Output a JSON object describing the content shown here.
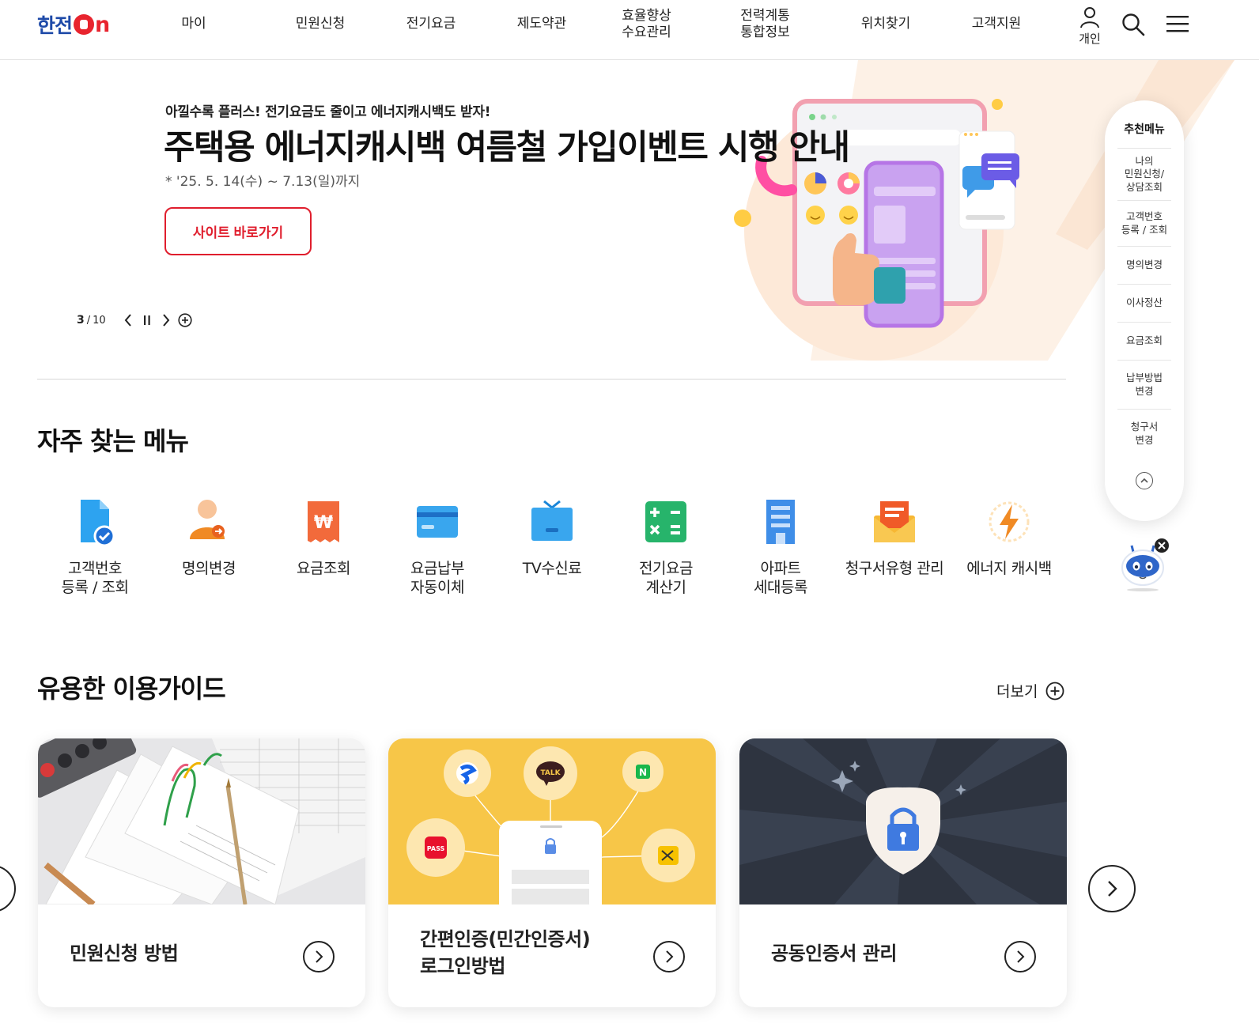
{
  "brand": {
    "logo_text": "한전",
    "logo_on": "n"
  },
  "header": {
    "nav": [
      {
        "label": "마이"
      },
      {
        "label": "민원신청"
      },
      {
        "label": "전기요금"
      },
      {
        "label": "제도약관"
      },
      {
        "label": "효율향상\n수요관리"
      },
      {
        "label": "전력계통\n통합정보"
      },
      {
        "label": "위치찾기"
      },
      {
        "label": "고객지원"
      }
    ],
    "user_label": "개인"
  },
  "hero": {
    "subtitle": "아낄수록 플러스! 전기요금도 줄이고 에너지캐시백도 받자!",
    "title": "주택용 에너지캐시백 여름철 가입이벤트 시행 안내",
    "date": "* '25. 5. 14(수) ~ 7.13(일)까지",
    "button_label": "사이트 바로가기",
    "pager": {
      "current": "3",
      "total": "10",
      "separator": "/"
    }
  },
  "frequent": {
    "title": "자주 찾는 메뉴",
    "items": [
      {
        "label": "고객번호\n등록 / 조회",
        "icon": "document-check-icon"
      },
      {
        "label": "명의변경",
        "icon": "person-change-icon"
      },
      {
        "label": "요금조회",
        "icon": "won-receipt-icon"
      },
      {
        "label": "요금납부\n자동이체",
        "icon": "credit-card-icon"
      },
      {
        "label": "TV수신료",
        "icon": "tv-icon"
      },
      {
        "label": "전기요금\n계산기",
        "icon": "calculator-icon"
      },
      {
        "label": "아파트\n세대등록",
        "icon": "apartment-icon"
      },
      {
        "label": "청구서유형 관리",
        "icon": "envelope-icon"
      },
      {
        "label": "에너지 캐시백",
        "icon": "energy-bolt-icon"
      }
    ]
  },
  "guide": {
    "title": "유용한 이용가이드",
    "more_label": "더보기",
    "cards": [
      {
        "caption": "민원신청 방법"
      },
      {
        "caption": "간편인증(민간인증서)\n로그인방법"
      },
      {
        "caption": "공동인증서 관리"
      }
    ],
    "card2_badges": {
      "talk": "TALK",
      "pass": "PASS",
      "naver": "N"
    }
  },
  "side_menu": {
    "title": "추천메뉴",
    "items": [
      {
        "label": "나의\n민원신청/\n상담조회"
      },
      {
        "label": "고객번호\n등록 / 조회"
      },
      {
        "label": "명의변경"
      },
      {
        "label": "이사정산"
      },
      {
        "label": "요금조회"
      },
      {
        "label": "납부방법\n변경"
      },
      {
        "label": "청구서\n변경"
      }
    ]
  },
  "colors": {
    "brand_blue": "#1e4aa8",
    "brand_red": "#e01e2d",
    "accent_orange": "#f08a24",
    "card_yellow": "#f7c648",
    "card_dark": "#2e3440"
  }
}
